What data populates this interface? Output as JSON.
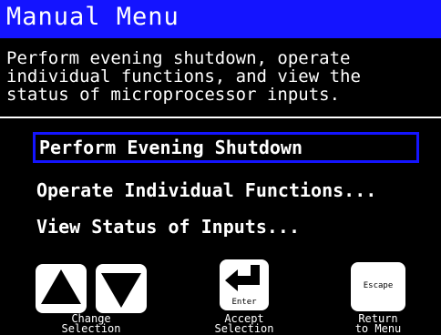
{
  "title": "Manual Menu",
  "description": "Perform evening shutdown, operate\nindividual functions, and view the\nstatus of microprocessor inputs.",
  "menu": {
    "options": [
      "Perform Evening Shutdown",
      "Operate Individual Functions...",
      "View Status of Inputs..."
    ],
    "selected_index": 0
  },
  "keys": {
    "change_label": "Change\nSelection",
    "accept_label": "Accept\nSelection",
    "accept_key_text": "Enter",
    "return_label": "Return\nto Menu",
    "return_key_text": "Escape"
  },
  "colors": {
    "title_bar": "#1414ff",
    "selection_border": "#1414ff",
    "background": "#000000",
    "text": "#ffffff"
  }
}
